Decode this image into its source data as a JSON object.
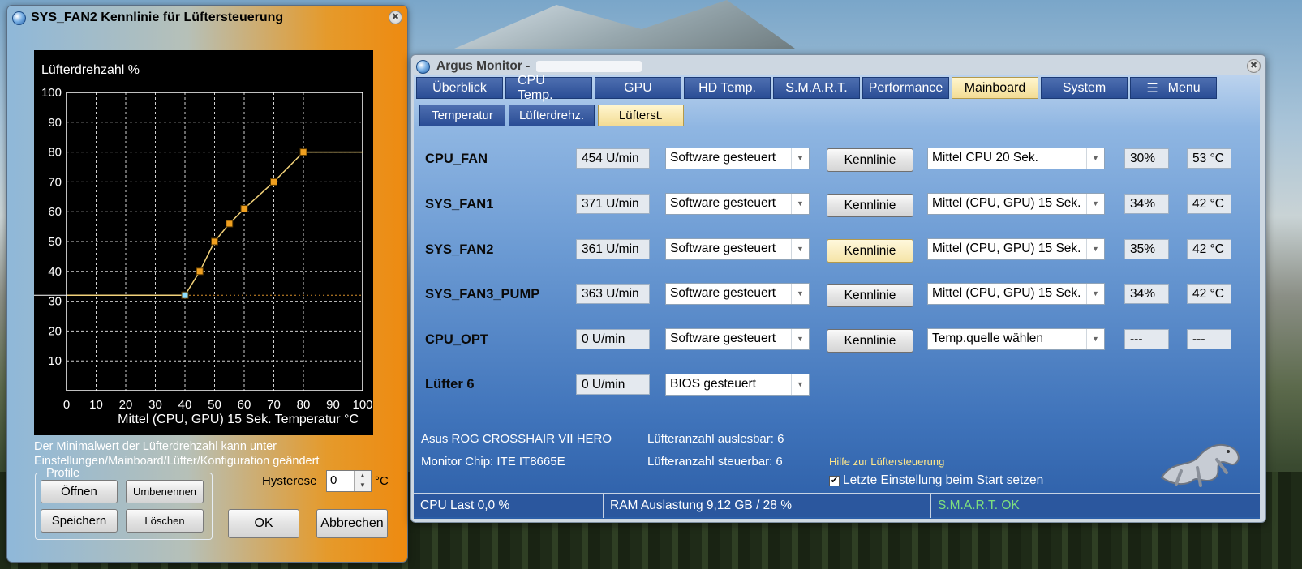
{
  "curve_dialog": {
    "title": "SYS_FAN2 Kennlinie für Lüftersteuerung",
    "close_glyph": "✖",
    "note": "Der Minimalwert der Lüfterdrehzahl kann unter Einstellungen/Mainboard/Lüfter/Konfiguration geändert",
    "profile_label": "Profile",
    "buttons": {
      "open": "Öffnen",
      "rename": "Umbenennen",
      "save": "Speichern",
      "delete": "Löschen",
      "ok": "OK",
      "cancel": "Abbrechen"
    },
    "hysteresis_label": "Hysterese",
    "hysteresis_value": "0",
    "hysteresis_unit": "°C"
  },
  "chart_data": {
    "type": "line",
    "ylabel": "Lüfterdrehzahl %",
    "xlabel": "Mittel (CPU, GPU) 15 Sek. Temperatur °C",
    "xlim": [
      0,
      100
    ],
    "ylim": [
      0,
      100
    ],
    "x_ticks": [
      "0",
      "10",
      "20",
      "30",
      "40",
      "50",
      "60",
      "70",
      "80",
      "90",
      "100"
    ],
    "y_ticks": [
      "10",
      "20",
      "30",
      "40",
      "50",
      "60",
      "70",
      "80",
      "90",
      "100"
    ],
    "grid": true,
    "series": [
      {
        "points": [
          [
            0,
            32
          ],
          [
            40,
            32
          ],
          [
            45,
            40
          ],
          [
            50,
            50
          ],
          [
            55,
            56
          ],
          [
            60,
            61
          ],
          [
            70,
            70
          ],
          [
            80,
            80
          ],
          [
            100,
            80
          ]
        ],
        "control_points": [
          [
            40,
            32
          ],
          [
            45,
            40
          ],
          [
            50,
            50
          ],
          [
            55,
            56
          ],
          [
            60,
            61
          ],
          [
            70,
            70
          ],
          [
            80,
            80
          ]
        ]
      }
    ],
    "current_x": 40,
    "colors": {
      "line": "#f2d27a",
      "point": "#f0a020",
      "active_point": "#8fe0ff",
      "grid": "#d0d0d0",
      "marker_line": "#d9902a"
    }
  },
  "argus": {
    "title": "Argus Monitor -",
    "close_glyph": "✖",
    "tabs": [
      {
        "label": "Überblick",
        "active": false
      },
      {
        "label": "CPU Temp.",
        "active": false
      },
      {
        "label": "GPU",
        "active": false
      },
      {
        "label": "HD Temp.",
        "active": false
      },
      {
        "label": "S.M.A.R.T.",
        "active": false
      },
      {
        "label": "Performance",
        "active": false
      },
      {
        "label": "Mainboard",
        "active": true
      },
      {
        "label": "System",
        "active": false
      },
      {
        "label": "Menu",
        "active": false
      }
    ],
    "subtabs": [
      {
        "label": "Temperatur",
        "active": false
      },
      {
        "label": "Lüfterdrehz.",
        "active": false
      },
      {
        "label": "Lüfterst.",
        "active": true
      }
    ],
    "fans": [
      {
        "name": "CPU_FAN",
        "rpm": "454 U/min",
        "mode": "Software gesteuert",
        "button": "Kennlinie",
        "source": "Mittel CPU 20 Sek.",
        "pct": "30%",
        "temp": "53 °C"
      },
      {
        "name": "SYS_FAN1",
        "rpm": "371 U/min",
        "mode": "Software gesteuert",
        "button": "Kennlinie",
        "source": "Mittel (CPU, GPU) 15 Sek.",
        "pct": "34%",
        "temp": "42 °C"
      },
      {
        "name": "SYS_FAN2",
        "rpm": "361 U/min",
        "mode": "Software gesteuert",
        "button": "Kennlinie",
        "source": "Mittel (CPU, GPU) 15 Sek.",
        "pct": "35%",
        "temp": "42 °C"
      },
      {
        "name": "SYS_FAN3_PUMP",
        "rpm": "363 U/min",
        "mode": "Software gesteuert",
        "button": "Kennlinie",
        "source": "Mittel (CPU, GPU) 15 Sek.",
        "pct": "34%",
        "temp": "42 °C"
      },
      {
        "name": "CPU_OPT",
        "rpm": "0 U/min",
        "mode": "Software gesteuert",
        "button": "Kennlinie",
        "source": "Temp.quelle wählen",
        "pct": "---",
        "temp": "---"
      },
      {
        "name": "Lüfter 6",
        "rpm": "0 U/min",
        "mode": "BIOS gesteuert"
      }
    ],
    "board": "Asus ROG CROSSHAIR VII HERO",
    "chip": "Monitor Chip: ITE IT8665E",
    "fans_readable": "Lüfteranzahl auslesbar: 6",
    "fans_controllable": "Lüfteranzahl steuerbar: 6",
    "help_link": "Hilfe zur Lüftersteuerung",
    "checkbox_label": "Letzte Einstellung beim Start setzen",
    "checkbox_checked": true,
    "status": {
      "cpu": "CPU Last 0,0 %",
      "ram": "RAM Auslastung 9,12 GB / 28 %",
      "smart": "S.M.A.R.T. OK"
    }
  }
}
